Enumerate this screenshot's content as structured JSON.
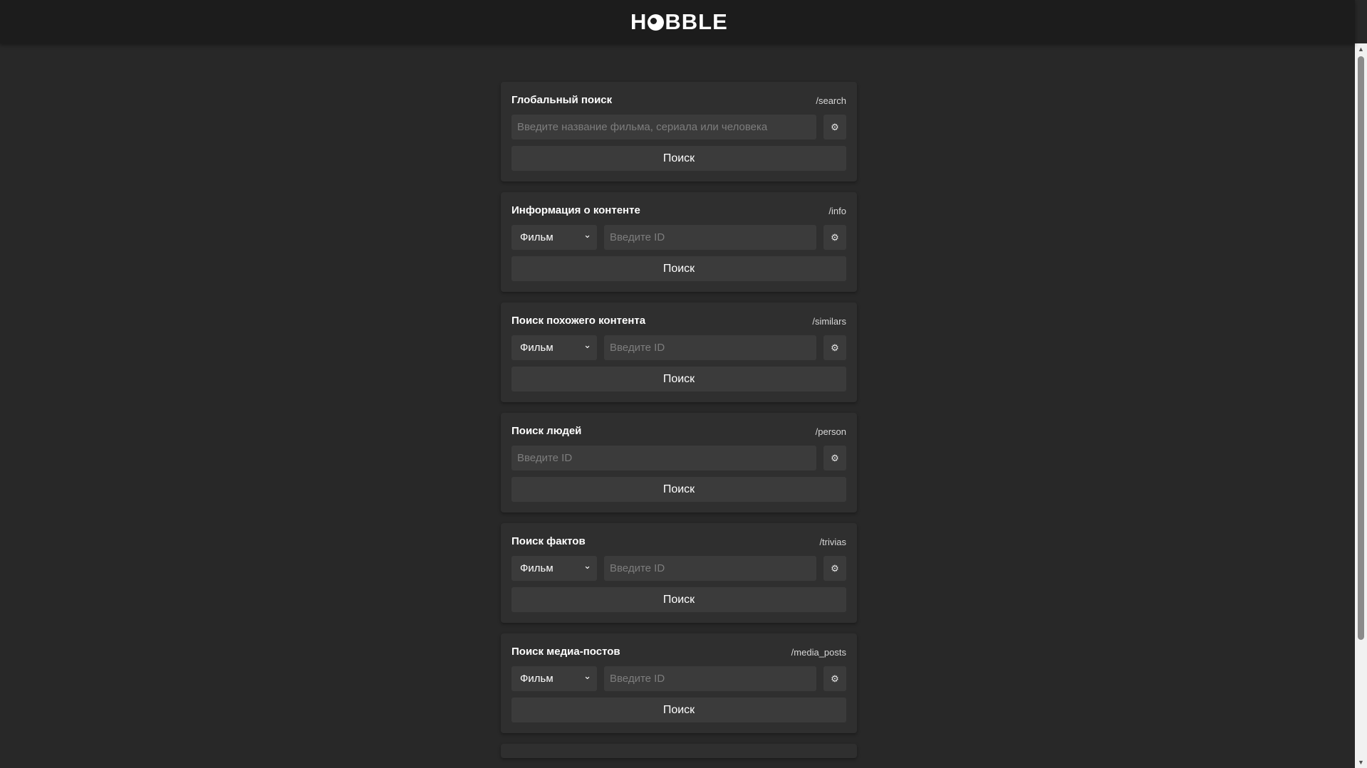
{
  "header": {
    "logo_text_left": "H",
    "logo_text_right": "BBLE"
  },
  "cards": [
    {
      "title": "Глобальный поиск",
      "endpoint": "/search",
      "has_select": false,
      "select_value": "",
      "placeholder": "Введите название фильма, сериала или человека",
      "button_label": "Поиск"
    },
    {
      "title": "Информация о контенте",
      "endpoint": "/info",
      "has_select": true,
      "select_value": "Фильм",
      "placeholder": "Введите ID",
      "button_label": "Поиск"
    },
    {
      "title": "Поиск похожего контента",
      "endpoint": "/similars",
      "has_select": true,
      "select_value": "Фильм",
      "placeholder": "Введите ID",
      "button_label": "Поиск"
    },
    {
      "title": "Поиск людей",
      "endpoint": "/person",
      "has_select": false,
      "select_value": "",
      "placeholder": "Введите ID",
      "button_label": "Поиск"
    },
    {
      "title": "Поиск фактов",
      "endpoint": "/trivias",
      "has_select": true,
      "select_value": "Фильм",
      "placeholder": "Введите ID",
      "button_label": "Поиск"
    },
    {
      "title": "Поиск медиа-постов",
      "endpoint": "/media_posts",
      "has_select": true,
      "select_value": "Фильм",
      "placeholder": "Введите ID",
      "button_label": "Поиск"
    }
  ],
  "icons": {
    "settings": "gear-icon",
    "select_arrow": "chevron-down-icon"
  },
  "colors": {
    "page_bg": "#282828",
    "header_bg": "#1c1c1c",
    "card_bg": "#2f2f2f",
    "control_bg": "#3b3b3b",
    "placeholder": "#7d7d7d"
  }
}
